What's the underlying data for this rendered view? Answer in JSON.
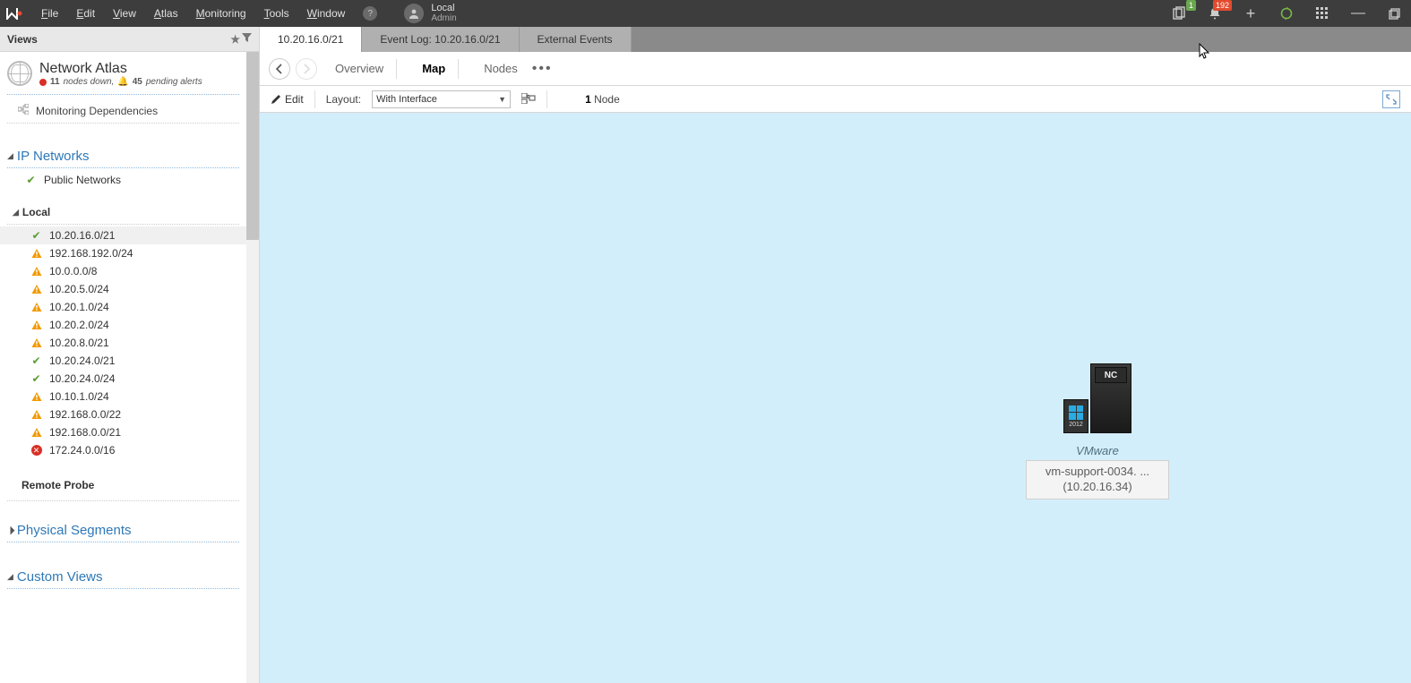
{
  "menubar": {
    "items": [
      "File",
      "Edit",
      "View",
      "Atlas",
      "Monitoring",
      "Tools",
      "Window"
    ],
    "user": {
      "name": "Local",
      "role": "Admin"
    },
    "badges": {
      "tasks": "1",
      "alerts": "192"
    }
  },
  "left_panel": {
    "header": "Views",
    "atlas": {
      "title": "Network Atlas",
      "nodes_down_count": "11",
      "nodes_down_label": "nodes down,",
      "pending_alerts_count": "45",
      "pending_alerts_label": "pending alerts"
    },
    "dependencies_label": "Monitoring Dependencies",
    "sections": {
      "ip_networks": {
        "title": "IP Networks",
        "public_label": "Public Networks",
        "local_header": "Local",
        "local_items": [
          {
            "label": "10.20.16.0/21",
            "status": "ok",
            "selected": true
          },
          {
            "label": "192.168.192.0/24",
            "status": "warn"
          },
          {
            "label": "10.0.0.0/8",
            "status": "warn"
          },
          {
            "label": "10.20.5.0/24",
            "status": "warn"
          },
          {
            "label": "10.20.1.0/24",
            "status": "warn"
          },
          {
            "label": "10.20.2.0/24",
            "status": "warn"
          },
          {
            "label": "10.20.8.0/21",
            "status": "warn"
          },
          {
            "label": "10.20.24.0/21",
            "status": "ok"
          },
          {
            "label": "10.20.24.0/24",
            "status": "ok"
          },
          {
            "label": "10.10.1.0/24",
            "status": "warn"
          },
          {
            "label": "192.168.0.0/22",
            "status": "warn"
          },
          {
            "label": "192.168.0.0/21",
            "status": "warn"
          },
          {
            "label": "172.24.0.0/16",
            "status": "err"
          }
        ],
        "remote_probe": "Remote Probe"
      },
      "physical_segments": "Physical Segments",
      "custom_views": "Custom Views"
    }
  },
  "tabs": [
    {
      "label": "10.20.16.0/21",
      "active": true
    },
    {
      "label": "Event Log: 10.20.16.0/21",
      "active": false
    },
    {
      "label": "External Events",
      "active": false
    }
  ],
  "subnav": {
    "overview": "Overview",
    "map": "Map",
    "nodes": "Nodes"
  },
  "toolbar": {
    "edit": "Edit",
    "layout_label": "Layout:",
    "layout_value": "With Interface",
    "node_count_num": "1",
    "node_count_word": "Node"
  },
  "map": {
    "node": {
      "os_year": "2012",
      "brand": "NC",
      "platform": "VMware",
      "name": "vm-support-0034. ...",
      "ip": "(10.20.16.34)"
    }
  }
}
